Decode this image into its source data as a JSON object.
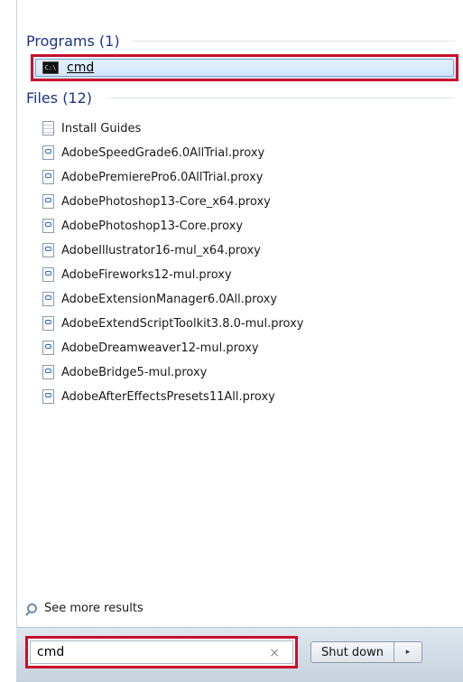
{
  "programs": {
    "header": "Programs (1)",
    "items": [
      {
        "label": "cmd",
        "icon": "cmd-icon"
      }
    ]
  },
  "files": {
    "header": "Files (12)",
    "items": [
      {
        "label": "Install Guides",
        "icon": "document-icon"
      },
      {
        "label": "AdobeSpeedGrade6.0AllTrial.proxy",
        "icon": "proxy-file-icon"
      },
      {
        "label": "AdobePremierePro6.0AllTrial.proxy",
        "icon": "proxy-file-icon"
      },
      {
        "label": "AdobePhotoshop13-Core_x64.proxy",
        "icon": "proxy-file-icon"
      },
      {
        "label": "AdobePhotoshop13-Core.proxy",
        "icon": "proxy-file-icon"
      },
      {
        "label": "AdobeIllustrator16-mul_x64.proxy",
        "icon": "proxy-file-icon"
      },
      {
        "label": "AdobeFireworks12-mul.proxy",
        "icon": "proxy-file-icon"
      },
      {
        "label": "AdobeExtensionManager6.0All.proxy",
        "icon": "proxy-file-icon"
      },
      {
        "label": "AdobeExtendScriptToolkit3.8.0-mul.proxy",
        "icon": "proxy-file-icon"
      },
      {
        "label": "AdobeDreamweaver12-mul.proxy",
        "icon": "proxy-file-icon"
      },
      {
        "label": "AdobeBridge5-mul.proxy",
        "icon": "proxy-file-icon"
      },
      {
        "label": "AdobeAfterEffectsPresets11All.proxy",
        "icon": "proxy-file-icon"
      }
    ]
  },
  "see_more": "See more results",
  "search": {
    "value": "cmd",
    "clear_glyph": "×"
  },
  "shutdown": {
    "label": "Shut down",
    "arrow_glyph": "▸"
  },
  "colors": {
    "header_text": "#1e3287",
    "highlight_outline": "#c8102e",
    "selected_bg": "#cfe3fa"
  }
}
